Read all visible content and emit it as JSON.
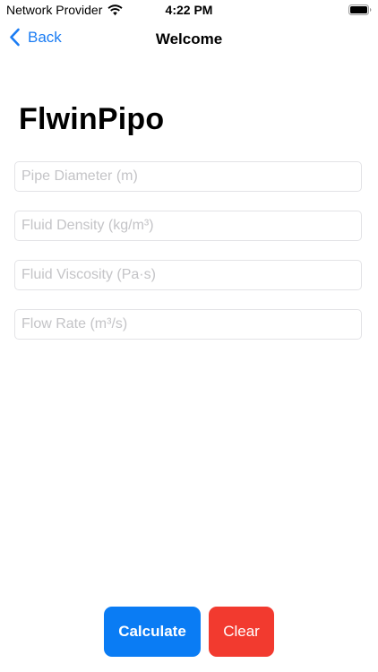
{
  "status_bar": {
    "carrier": "Network Provider",
    "time": "4:22 PM"
  },
  "nav": {
    "back_label": "Back",
    "title": "Welcome"
  },
  "page": {
    "title": "FlwinPipo"
  },
  "form": {
    "fields": [
      {
        "placeholder": "Pipe Diameter (m)",
        "value": ""
      },
      {
        "placeholder": "Fluid Density (kg/m³)",
        "value": ""
      },
      {
        "placeholder": "Fluid Viscosity (Pa·s)",
        "value": ""
      },
      {
        "placeholder": "Flow Rate (m³/s)",
        "value": ""
      }
    ]
  },
  "actions": {
    "calculate_label": "Calculate",
    "clear_label": "Clear"
  },
  "colors": {
    "accent": "#1a7cf3",
    "calculate_bg": "#0a7cf4",
    "clear_bg": "#f23a2f"
  },
  "icons": {
    "wifi": "wifi-icon",
    "battery": "battery-icon",
    "back": "chevron-left-icon"
  }
}
